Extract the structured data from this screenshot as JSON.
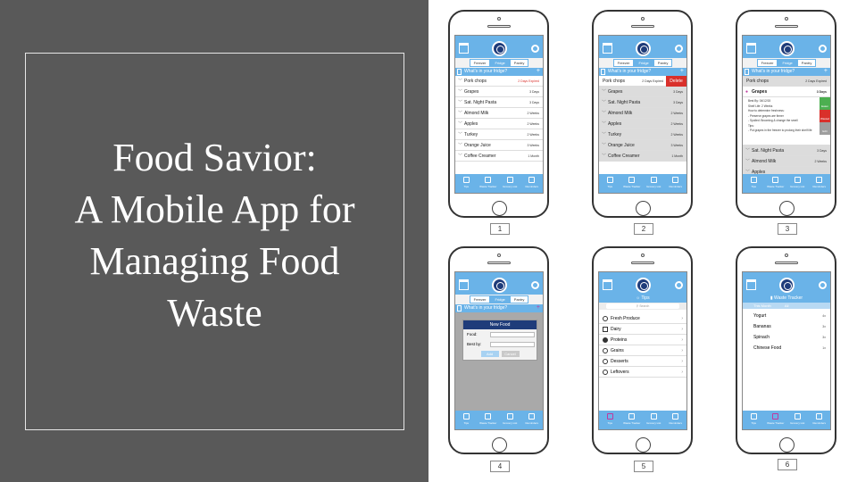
{
  "slide": {
    "title_lines": [
      "Food Savior:",
      "A Mobile App for",
      "Managing Food",
      "Waste"
    ]
  },
  "common": {
    "segments": [
      "Freezer",
      "Fridge",
      "Pantry"
    ],
    "fridge_header": "What's in your fridge?",
    "tabs": [
      "Tips",
      "Waste Tracker",
      "Grocery List",
      "Reminders"
    ]
  },
  "screens": {
    "s1": {
      "caption": "1",
      "items": [
        {
          "name": "Pork chops",
          "value": "2 Days Expired",
          "alert": true
        },
        {
          "name": "Grapes",
          "value": "3 Days"
        },
        {
          "name": "Sat. Night Pasta",
          "value": "3 Days"
        },
        {
          "name": "Almond Milk",
          "value": "2 Weeks"
        },
        {
          "name": "Apples",
          "value": "2 Weeks"
        },
        {
          "name": "Turkey",
          "value": "2 Weeks"
        },
        {
          "name": "Orange Juice",
          "value": "3 Weeks"
        },
        {
          "name": "Coffee Creamer",
          "value": "1 Month"
        }
      ]
    },
    "s2": {
      "caption": "2",
      "delete_label": "Delete",
      "items": [
        {
          "name": "Pork chops",
          "value": "2 Days Expired"
        },
        {
          "name": "Grapes",
          "value": "3 Days"
        },
        {
          "name": "Sat. Night Pasta",
          "value": "3 Days"
        },
        {
          "name": "Almond Milk",
          "value": "2 Weeks"
        },
        {
          "name": "Apples",
          "value": "2 Weeks"
        },
        {
          "name": "Turkey",
          "value": "2 Weeks"
        },
        {
          "name": "Orange Juice",
          "value": "3 Weeks"
        },
        {
          "name": "Coffee Creamer",
          "value": "1 Month"
        }
      ]
    },
    "s3": {
      "caption": "3",
      "top_item": {
        "name": "Pork chops",
        "value": "2 Days Expired"
      },
      "expanded": {
        "name": "Grapes",
        "value": "3 Days"
      },
      "detail_lines": [
        "Best By: 04/12/15",
        "Shelf Life: 2 Weeks",
        "How to determine freshness:",
        "- Preserve grapes are firmer",
        "- Spoiled: Browning & change the smell",
        "Tips:",
        "- Put grapes in the freezer to prolong their shelf life"
      ],
      "actions": [
        "Eaten",
        "Wasted",
        "Edit"
      ],
      "after_items": [
        {
          "name": "Sat. Night Pasta",
          "value": "3 Days"
        },
        {
          "name": "Almond Milk",
          "value": "2 Weeks"
        },
        {
          "name": "Apples",
          "value": ""
        }
      ]
    },
    "s4": {
      "caption": "4",
      "modal_title": "New Food",
      "food_label": "Food:",
      "bestby_label": "Best by:",
      "add_label": "Add",
      "cancel_label": "Cancel"
    },
    "s5": {
      "caption": "5",
      "header": "Tips",
      "search_placeholder": "Search",
      "categories": [
        "Fresh Produce",
        "Dairy",
        "Proteins",
        "Grains",
        "Desserts",
        "Leftovers"
      ]
    },
    "s6": {
      "caption": "6",
      "header": "Waste Tracker",
      "filter_left": "This Month",
      "filter_right": "All",
      "items": [
        {
          "name": "Yogurt",
          "qty": "4x"
        },
        {
          "name": "Bananas",
          "qty": "3x"
        },
        {
          "name": "Spinach",
          "qty": "3x"
        },
        {
          "name": "Chinese Food",
          "qty": "1x"
        }
      ]
    }
  },
  "colors": {
    "accent": "#6ab3e8",
    "navy": "#1f3c7a",
    "alert": "#d9302b",
    "panel": "#595959"
  }
}
